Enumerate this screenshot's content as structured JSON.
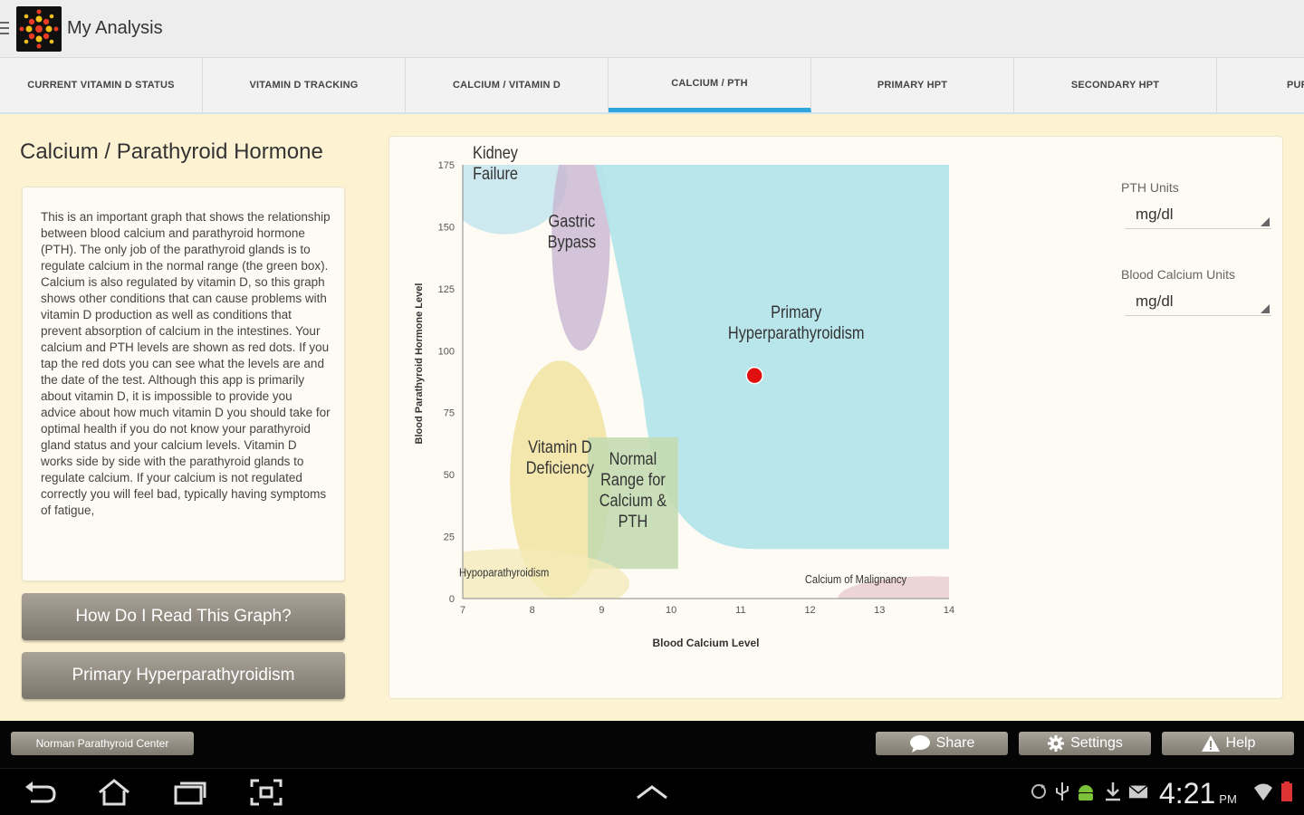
{
  "app": {
    "title": "My Analysis",
    "logo_icon": "flower-logo-icon"
  },
  "tabs": [
    {
      "label": "CURRENT VITAMIN D STATUS",
      "active": false
    },
    {
      "label": "VITAMIN D TRACKING",
      "active": false
    },
    {
      "label": "CALCIUM / VITAMIN D",
      "active": false
    },
    {
      "label": "CALCIUM / PTH",
      "active": true
    },
    {
      "label": "PRIMARY HPT",
      "active": false
    },
    {
      "label": "SECONDARY HPT",
      "active": false
    },
    {
      "label": "PURE VITAM",
      "active": false
    }
  ],
  "panel": {
    "title": "Calcium / Parathyroid Hormone",
    "description": "This is an important graph that shows the relationship between blood calcium and parathyroid hormone (PTH). The only job of the parathyroid glands is to regulate calcium in the normal range (the green box). Calcium is also regulated by vitamin D, so this graph shows other conditions that can cause problems with vitamin D production as well as conditions that prevent absorption of calcium in the intestines. Your calcium and PTH levels are shown as red dots. If you tap the red dots you can see what the levels are and the date of the test. Although this app is primarily about vitamin D, it is impossible to provide you advice about how much vitamin D you should take for optimal health if you do not know your parathyroid gland status and your calcium levels. Vitamin D works side by side with the parathyroid glands to regulate calcium. If your calcium is not regulated correctly you will feel bad, typically having symptoms of fatigue,",
    "button_read": "How Do I Read This Graph?",
    "button_condition": "Primary Hyperparathyroidism"
  },
  "controls": {
    "pth_units_label": "PTH Units",
    "pth_units_value": "mg/dl",
    "calcium_units_label": "Blood Calcium Units",
    "calcium_units_value": "mg/dl"
  },
  "chart_data": {
    "type": "scatter",
    "xlabel": "Blood Calcium Level",
    "ylabel": "Blood Parathyroid Hormone Level",
    "xlim": [
      7,
      14
    ],
    "ylim": [
      0,
      175
    ],
    "x_ticks": [
      "7",
      "8",
      "9",
      "10",
      "11",
      "12",
      "13",
      "14"
    ],
    "y_ticks": [
      "0",
      "25",
      "50",
      "75",
      "100",
      "125",
      "150",
      "175"
    ],
    "regions": [
      {
        "name": "Kidney Failure",
        "lines": [
          "Kidney",
          "Failure"
        ],
        "color": "#bfe3ec",
        "shape": "ellipse",
        "cx": 7.6,
        "cy": 169,
        "rx": 0.9,
        "ry": 22
      },
      {
        "name": "Gastric Bypass",
        "lines": [
          "Gastric",
          "Bypass"
        ],
        "color": "#c8b5d2",
        "shape": "ellipse",
        "cx": 8.7,
        "cy": 145,
        "rx": 0.42,
        "ry": 45
      },
      {
        "name": "Primary Hyperparathyroidism",
        "lines": [
          "Primary",
          "Hyperparathyroidism"
        ],
        "color": "#b3e4ea",
        "shape": "curve",
        "label_x": 11.8,
        "label_y": 109
      },
      {
        "name": "Vitamin D Deficiency",
        "lines": [
          "Vitamin D",
          "Deficiency"
        ],
        "color": "#f1e29a",
        "shape": "ellipse",
        "cx": 8.4,
        "cy": 48,
        "rx": 0.72,
        "ry": 48
      },
      {
        "name": "Normal Range for Calcium & PTH",
        "lines": [
          "Normal",
          "Range for",
          "Calcium &",
          "PTH"
        ],
        "color": "#c3dbb0",
        "shape": "rect",
        "x0": 8.8,
        "x1": 10.1,
        "y0": 12,
        "y1": 65
      },
      {
        "name": "Calcium of Malignancy",
        "lines": [
          "Calcium of Malignancy"
        ],
        "color": "#e8c9cc",
        "shape": "ellipse",
        "cx": 13.7,
        "cy": 0,
        "rx": 1.3,
        "ry": 9
      },
      {
        "name": "Hypoparathyroidism",
        "lines": [
          "Hypoparathyroidism"
        ],
        "color": "#f3ebb8",
        "shape": "ellipse",
        "cx": 7.7,
        "cy": 6,
        "rx": 1.7,
        "ry": 14
      }
    ],
    "points": [
      {
        "x": 11.2,
        "y": 90,
        "color": "#e01010"
      }
    ]
  },
  "bottombar": {
    "credit": "Norman Parathyroid Center",
    "share": "Share",
    "settings": "Settings",
    "help": "Help"
  },
  "system": {
    "time": "4:21",
    "ampm": "PM"
  }
}
